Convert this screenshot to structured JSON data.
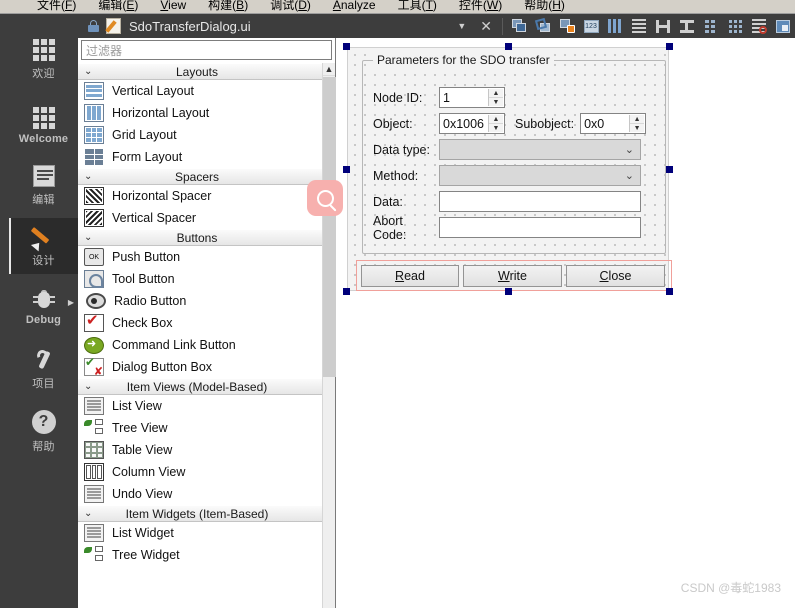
{
  "menubar": {
    "items": [
      {
        "pre": "文件(",
        "key": "F",
        "post": ")"
      },
      {
        "pre": "编辑(",
        "key": "E",
        "post": ")"
      },
      {
        "pre": "",
        "key": "V",
        "post": "iew"
      },
      {
        "pre": "构建(",
        "key": "B",
        "post": ")"
      },
      {
        "pre": "调试(",
        "key": "D",
        "post": ")"
      },
      {
        "pre": "",
        "key": "A",
        "post": "nalyze"
      },
      {
        "pre": "工具(",
        "key": "T",
        "post": ")"
      },
      {
        "pre": "控件(",
        "key": "W",
        "post": ")"
      },
      {
        "pre": "帮助(",
        "key": "H",
        "post": ")"
      }
    ]
  },
  "activity_bar": {
    "items": [
      {
        "label": "欢迎",
        "icon": "grid-icon",
        "selected": false
      },
      {
        "label": "Welcome",
        "icon": "grid-icon",
        "selected": false
      },
      {
        "label": "编辑",
        "icon": "document-icon",
        "selected": false
      },
      {
        "label": "设计",
        "icon": "pencil-icon",
        "selected": true
      },
      {
        "label": "Debug",
        "icon": "bug-icon",
        "selected": false
      },
      {
        "label": "项目",
        "icon": "wrench-icon",
        "selected": false
      },
      {
        "label": "帮助",
        "icon": "question-circle-icon",
        "selected": false
      }
    ]
  },
  "tabbar": {
    "filename": "SdoTransferDialog.ui",
    "lock_icon": "lock-icon",
    "file_icon": "ui-file-icon",
    "dropdown_icon": "chevron-down-icon",
    "close_icon": "close-icon",
    "tools": [
      {
        "name": "adjust-size-icon",
        "label": "Adjust Size"
      },
      {
        "name": "break-layout-icon",
        "label": "Break Layout"
      },
      {
        "name": "layout-preview-icon",
        "label": "Preview"
      },
      {
        "name": "buddy-edit-icon",
        "label": "Edit Buddies"
      },
      {
        "name": "lay-out-horizontally-icon",
        "label": "Lay Out Horizontally"
      },
      {
        "name": "lay-out-vertically-icon",
        "label": "Lay Out Vertically"
      },
      {
        "name": "lay-out-horizontally-in-splitter-icon",
        "label": "Lay Out Horizontally in Splitter"
      },
      {
        "name": "lay-out-vertically-in-splitter-icon",
        "label": "Lay Out Vertically in Splitter"
      },
      {
        "name": "lay-out-in-form-layout-icon",
        "label": "Lay Out in a Form Layout"
      },
      {
        "name": "lay-out-in-grid-icon",
        "label": "Lay Out in a Grid"
      },
      {
        "name": "break-layout-2-icon",
        "label": "Break Layout"
      },
      {
        "name": "image-preview-icon",
        "label": "Preview Image"
      }
    ]
  },
  "widget_box": {
    "filter_placeholder": "过滤器",
    "scroll_up_icon": "chevron-up-icon",
    "categories": [
      {
        "title": "Layouts",
        "items": [
          {
            "label": "Vertical Layout",
            "icon": "vertical-layout-icon"
          },
          {
            "label": "Horizontal Layout",
            "icon": "horizontal-layout-icon"
          },
          {
            "label": "Grid Layout",
            "icon": "grid-layout-icon"
          },
          {
            "label": "Form Layout",
            "icon": "form-layout-icon"
          }
        ]
      },
      {
        "title": "Spacers",
        "items": [
          {
            "label": "Horizontal Spacer",
            "icon": "horizontal-spacer-icon"
          },
          {
            "label": "Vertical Spacer",
            "icon": "vertical-spacer-icon"
          }
        ]
      },
      {
        "title": "Buttons",
        "items": [
          {
            "label": "Push Button",
            "icon": "push-button-icon"
          },
          {
            "label": "Tool Button",
            "icon": "tool-button-icon"
          },
          {
            "label": "Radio Button",
            "icon": "radio-button-icon"
          },
          {
            "label": "Check Box",
            "icon": "check-box-icon"
          },
          {
            "label": "Command Link Button",
            "icon": "command-link-button-icon"
          },
          {
            "label": "Dialog Button Box",
            "icon": "dialog-button-box-icon"
          }
        ]
      },
      {
        "title": "Item Views (Model-Based)",
        "items": [
          {
            "label": "List View",
            "icon": "list-view-icon"
          },
          {
            "label": "Tree View",
            "icon": "tree-view-icon"
          },
          {
            "label": "Table View",
            "icon": "table-view-icon"
          },
          {
            "label": "Column View",
            "icon": "column-view-icon"
          },
          {
            "label": "Undo View",
            "icon": "undo-view-icon"
          }
        ]
      },
      {
        "title": "Item Widgets (Item-Based)",
        "items": [
          {
            "label": "List Widget",
            "icon": "list-widget-icon"
          },
          {
            "label": "Tree Widget",
            "icon": "tree-widget-icon"
          }
        ]
      }
    ],
    "search_badge_icon": "search-icon"
  },
  "designer": {
    "groupbox_title": "Parameters for the SDO transfer",
    "fields": [
      {
        "label": "Node ID:",
        "type": "spinbox",
        "value": "1"
      },
      {
        "label": "Object:",
        "type": "spinbox",
        "value": "0x1006"
      },
      {
        "label": "Subobject:",
        "type": "spinbox",
        "value": "0x0"
      },
      {
        "label": "Data type:",
        "type": "combobox",
        "value": ""
      },
      {
        "label": "Method:",
        "type": "combobox",
        "value": ""
      },
      {
        "label": "Data:",
        "type": "lineedit",
        "value": ""
      },
      {
        "label": "Abort Code:",
        "type": "lineedit",
        "value": ""
      }
    ],
    "buttons": [
      {
        "mnemonic": "R",
        "rest": "ead"
      },
      {
        "mnemonic": "W",
        "rest": "rite"
      },
      {
        "mnemonic": "C",
        "rest": "lose"
      }
    ],
    "selection_color": "#00007a",
    "button_row_highlight_color": "#f0a09a"
  },
  "watermark": {
    "text": "CSDN @毒蛇1983"
  }
}
